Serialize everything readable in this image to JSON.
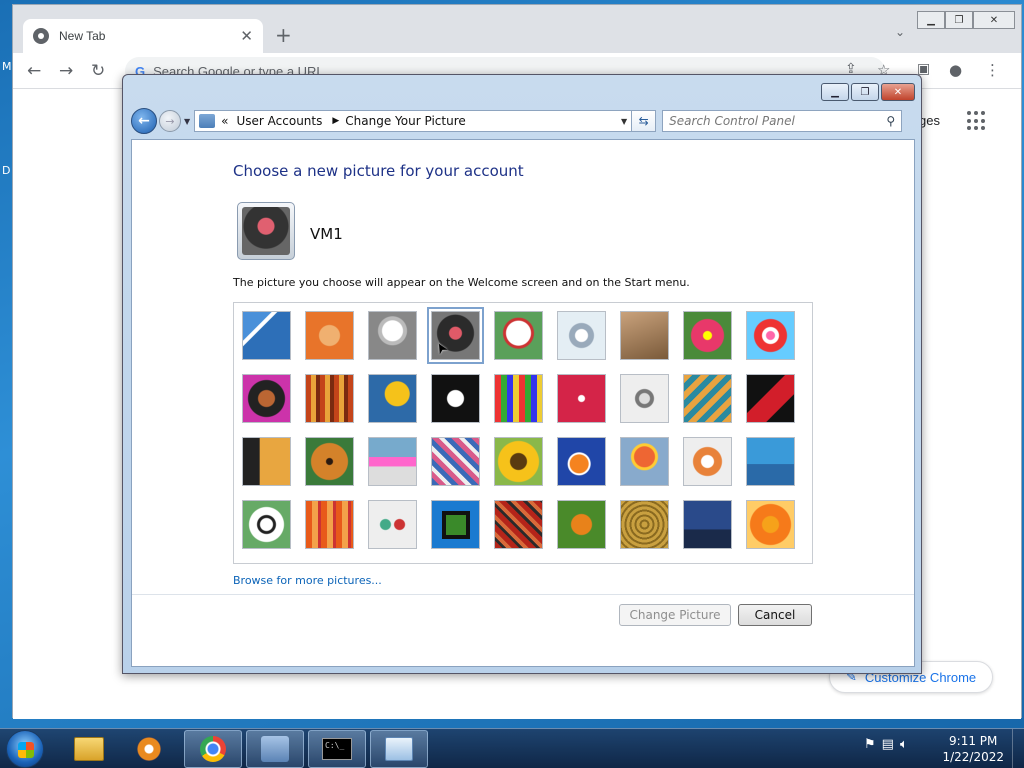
{
  "desktop": {
    "letter_m": "M",
    "letter_d": "D"
  },
  "chrome": {
    "tab_title": "New Tab",
    "tab_close": "✕",
    "new_tab": "+",
    "tab_menu": "⌄",
    "omnibox_placeholder": "Search Google or type a URL",
    "omnibox_g": "G",
    "images_partial": "ges",
    "customize_label": "Customize Chrome",
    "icons": [
      "back-arrow",
      "forward-arrow",
      "reload",
      "share",
      "star",
      "side-panel",
      "profile",
      "menu-dots",
      "apps-grid",
      "pencil"
    ]
  },
  "cp": {
    "breadcrumb_prefix": "«",
    "breadcrumb_1": "User Accounts",
    "breadcrumb_2": "Change Your Picture",
    "search_placeholder": "Search Control Panel",
    "heading": "Choose a new picture for your account",
    "user_name": "VM1",
    "description": "The picture you choose will appear on the Welcome screen and on the Start menu.",
    "pictures": [
      "roller-coaster",
      "starfish",
      "robot-toy",
      "record-player",
      "lucky-cat",
      "spinning-top",
      "kitten",
      "pink-flower",
      "ferris-wheel",
      "beetle-ball",
      "fabric-stripes",
      "ginkgo-leaf",
      "border-collie",
      "crayons",
      "paper-star",
      "jacks",
      "staircase",
      "paper-crane",
      "guitar",
      "pomeranian",
      "tin-robot",
      "fabric-weave",
      "sunflower",
      "clownfish",
      "hot-air-balloon",
      "doll",
      "sailboat",
      "soccer-ball",
      "fabric-orange",
      "marbles",
      "green-window",
      "textile-pattern",
      "butterfly",
      "wicker",
      "lighthouse",
      "orange-daisy"
    ],
    "selected_index": 3,
    "browse_link": "Browse for more pictures...",
    "change_button": "Change Picture",
    "cancel_button": "Cancel"
  },
  "taskbar": {
    "items": [
      "windows-explorer",
      "media-player",
      "google-chrome",
      "user-accounts",
      "command-prompt",
      "control-panel"
    ],
    "cmd_text": "C:\\_",
    "time": "9:11 PM",
    "date": "1/22/2022"
  }
}
